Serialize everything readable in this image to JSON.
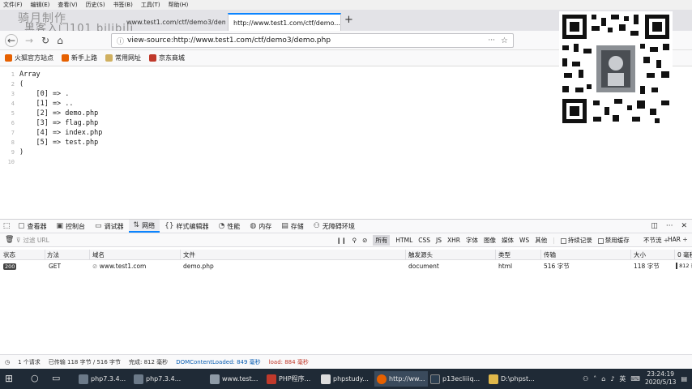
{
  "menubar": [
    "文件(F)",
    "编辑(E)",
    "查看(V)",
    "历史(S)",
    "书签(B)",
    "工具(T)",
    "帮助(H)"
  ],
  "watermark": {
    "line1": "骑月制作",
    "line2": "黑客入门101 bilibili"
  },
  "tabs": [
    {
      "label": "www.test1.com/ctf/demo3/demo..."
    },
    {
      "label": "http://www.test1.com/ctf/demo..."
    }
  ],
  "url": "view-source:http://www.test1.com/ctf/demo3/demo.php",
  "bookmarks": [
    "火狐官方站点",
    "新手上路",
    "常用网址",
    "京东商城"
  ],
  "source_lines": [
    {
      "no": "1",
      "text": "Array"
    },
    {
      "no": "2",
      "text": "("
    },
    {
      "no": "3",
      "text": "    [0] => ."
    },
    {
      "no": "4",
      "text": "    [1] => .."
    },
    {
      "no": "5",
      "text": "    [2] => demo.php"
    },
    {
      "no": "6",
      "text": "    [3] => flag.php"
    },
    {
      "no": "7",
      "text": "    [4] => index.php"
    },
    {
      "no": "8",
      "text": "    [5] => test.php"
    },
    {
      "no": "9",
      "text": ")"
    },
    {
      "no": "10",
      "text": ""
    }
  ],
  "devtools": {
    "tabs": [
      "查看器",
      "控制台",
      "调试器",
      "网络",
      "样式编辑器",
      "性能",
      "内存",
      "存储",
      "无障碍环境"
    ],
    "active_tab": "网络",
    "filter_placeholder": "过滤 URL",
    "type_filters": [
      "所有",
      "HTML",
      "CSS",
      "JS",
      "XHR",
      "字体",
      "图像",
      "媒体",
      "WS",
      "其他"
    ],
    "persist_label": "持续记录",
    "disable_cache_label": "禁用缓存",
    "throttle": "不节流 ÷",
    "har": "HAR ÷",
    "columns": [
      "状态",
      "方法",
      "域名",
      "文件",
      "触发源头",
      "类型",
      "传输",
      "大小",
      "0 毫秒"
    ],
    "request": {
      "status": "200",
      "method": "GET",
      "domain": "www.test1.com",
      "file": "demo.php",
      "cause": "document",
      "type": "html",
      "transferred": "516 字节",
      "size": "118 字节",
      "timeline": "812 毫"
    },
    "summary": {
      "requests": "1 个请求",
      "transferred": "已传输 118 字节 / 516 字节",
      "finish": "完成: 812 毫秒",
      "domcontent": "DOMContentLoaded: 849 毫秒",
      "load": "load: 884 毫秒"
    }
  },
  "taskbar": {
    "items": [
      "php7.3.4...",
      "php7.3.4...",
      "www.test...",
      "PHP程序...",
      "phpstudy...",
      "http://ww...",
      "p13ecliiiq...",
      "D:\\phpst..."
    ],
    "ime": "英",
    "time": "23:24:19",
    "date": "2020/5/13"
  }
}
